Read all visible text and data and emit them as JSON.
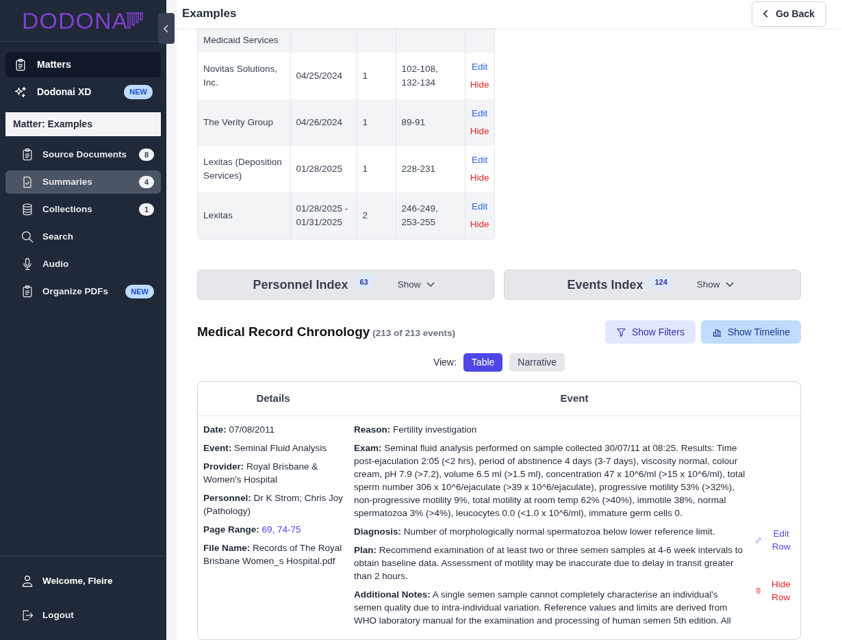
{
  "logo": {
    "text": "DODONA"
  },
  "nav": [
    {
      "label": "Matters",
      "selected": true
    },
    {
      "label": "Dodonai XD",
      "tag": "NEW",
      "selected": false
    }
  ],
  "matter_heading": "Matter: Examples",
  "sub_nav": [
    {
      "label": "Source Documents",
      "count": "8",
      "selected": false
    },
    {
      "label": "Summaries",
      "count": "4",
      "selected": true
    },
    {
      "label": "Collections",
      "count": "1",
      "selected": false
    },
    {
      "label": "Search",
      "selected": false
    },
    {
      "label": "Audio",
      "selected": false
    },
    {
      "label": "Organize PDFs",
      "tag": "NEW",
      "selected": false
    }
  ],
  "footer": [
    {
      "label": "Welcome, Fleire",
      "kind": "welcome"
    },
    {
      "label": "Logout",
      "kind": "link"
    }
  ],
  "header": {
    "title": "Examples",
    "back_button": "Go Back"
  },
  "providers_table": {
    "rows": [
      {
        "cells": [
          "Medicaid Services",
          "",
          "",
          ""
        ]
      },
      {
        "cells": [
          "Novitas Solutions, Inc.",
          "04/25/2024",
          "1",
          "102-108, 132-134"
        ],
        "edit": "Edit",
        "hide": "Hide"
      },
      {
        "cells": [
          "The Verity Group",
          "04/26/2024",
          "1",
          "89-91"
        ],
        "edit": "Edit",
        "hide": "Hide"
      },
      {
        "cells": [
          "Lexitas (Deposition Services)",
          "01/28/2025",
          "1",
          "228-231"
        ],
        "edit": "Edit",
        "hide": "Hide"
      },
      {
        "cells": [
          "Lexitas",
          "01/28/2025 - 01/31/2025",
          "2",
          "246-249, 253-255"
        ],
        "edit": "Edit",
        "hide": "Hide"
      }
    ]
  },
  "indexes": [
    {
      "title": "Personnel Index",
      "count": "63",
      "toggle": "Show"
    },
    {
      "title": "Events Index",
      "count": "124",
      "toggle": "Show"
    }
  ],
  "chronology": {
    "title": "Medical Record Chronology",
    "subtitle": "(213 of 213 events)",
    "filter_button": "Show Filters",
    "timeline_button": "Show Timeline",
    "view_label": "View:",
    "views": [
      {
        "label": "Table",
        "selected": true
      },
      {
        "label": "Narrative",
        "selected": false
      }
    ],
    "columns": [
      "Details",
      "Event"
    ],
    "rows": [
      {
        "details": [
          {
            "label": "Date:",
            "value": "07/08/2011",
            "kind": "text"
          },
          {
            "label": "Event:",
            "value": "Seminal Fluid Analysis",
            "kind": "text"
          },
          {
            "label": "Provider:",
            "value": "Royal Brisbane & Women's Hospital",
            "kind": "text"
          },
          {
            "label": "Personnel:",
            "value": "Dr K Strom; Chris Joy (Pathology)",
            "kind": "text"
          },
          {
            "label": "Page Range:",
            "value": "69, 74-75",
            "kind": "link"
          },
          {
            "label": "File Name:",
            "value": "Records of The Royal Brisbane Women_s Hospital.pdf",
            "kind": "text"
          }
        ],
        "event": [
          {
            "label": "Reason:",
            "text": "Fertility investigation"
          },
          {
            "label": "Exam:",
            "text": "Seminal fluid analysis performed on sample collected 30/07/11 at 08:25. Results: Time post-ejaculation 2:05 (<2 hrs), period of abstinence 4 days (3-7 days), viscosity normal, colour cream, pH 7.9 (>7.2), volume 6.5 ml (>1.5 ml), concentration 47 x 10^6/ml (>15 x 10^6/ml), total sperm number 306 x 10^6/ejaculate (>39 x 10^6/ejaculate), progressive motility 53% (>32%), non-progressive motility 9%, total motility at room temp 62% (>40%), immotile 38%, normal spermatozoa 3% (>4%), leucocytes 0.0 (<1.0 x 10^6/ml), immature germ cells 0."
          },
          {
            "label": "Diagnosis:",
            "text": "Number of morphologically normal spermatozoa below lower reference limit."
          },
          {
            "label": "Plan:",
            "text": "Recommend examination of at least two or three semen samples at 4-6 week intervals to obtain baseline data. Assessment of motility may be inaccurate due to delay in transit greater than 2 hours."
          },
          {
            "label": "Additional Notes:",
            "text": "A single semen sample cannot completely characterise an individual's semen quality due to intra-individual variation. Reference values and limits are derived from WHO laboratory manual for the examination and processing of human semen 5th edition. All"
          }
        ],
        "edit_row": "Edit Row",
        "hide_row": "Hide Row"
      }
    ]
  }
}
